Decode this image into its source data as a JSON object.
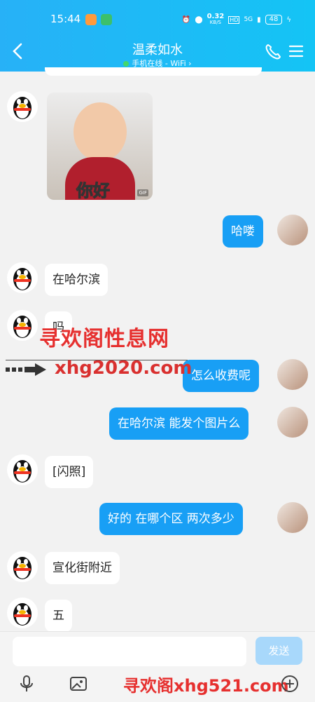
{
  "status": {
    "time": "15:44",
    "speed_value": "0.32",
    "speed_unit": "KB/S",
    "hd": "HD",
    "network": "5G",
    "battery": "48"
  },
  "header": {
    "title": "温柔如水",
    "subtitle": "手机在线 - WiFi"
  },
  "messages": [
    {
      "side": "left",
      "text": "在哈尔滨"
    },
    {
      "side": "left",
      "text": "吗"
    },
    {
      "side": "right",
      "text": "哈喽"
    },
    {
      "side": "right",
      "text": "怎么收费呢"
    },
    {
      "side": "right",
      "text": "在哈尔滨  能发个图片么"
    },
    {
      "side": "left",
      "text": "[闪照]"
    },
    {
      "side": "right",
      "text": "好的  在哪个区  两次多少"
    },
    {
      "side": "left",
      "text": "宣化街附近"
    },
    {
      "side": "left",
      "text": "五"
    }
  ],
  "photo": {
    "caption": "你好",
    "tag": "GIF"
  },
  "watermark": {
    "line1": "寻欢阁性息网",
    "line2": "xhg2020.com",
    "line3": "寻欢阁xhg521.com"
  },
  "input": {
    "placeholder": "",
    "send_label": "发送"
  },
  "colors": {
    "header": "#1eb9f6",
    "bubble_right": "#189ff5",
    "send_disabled": "#a8d8fb"
  }
}
